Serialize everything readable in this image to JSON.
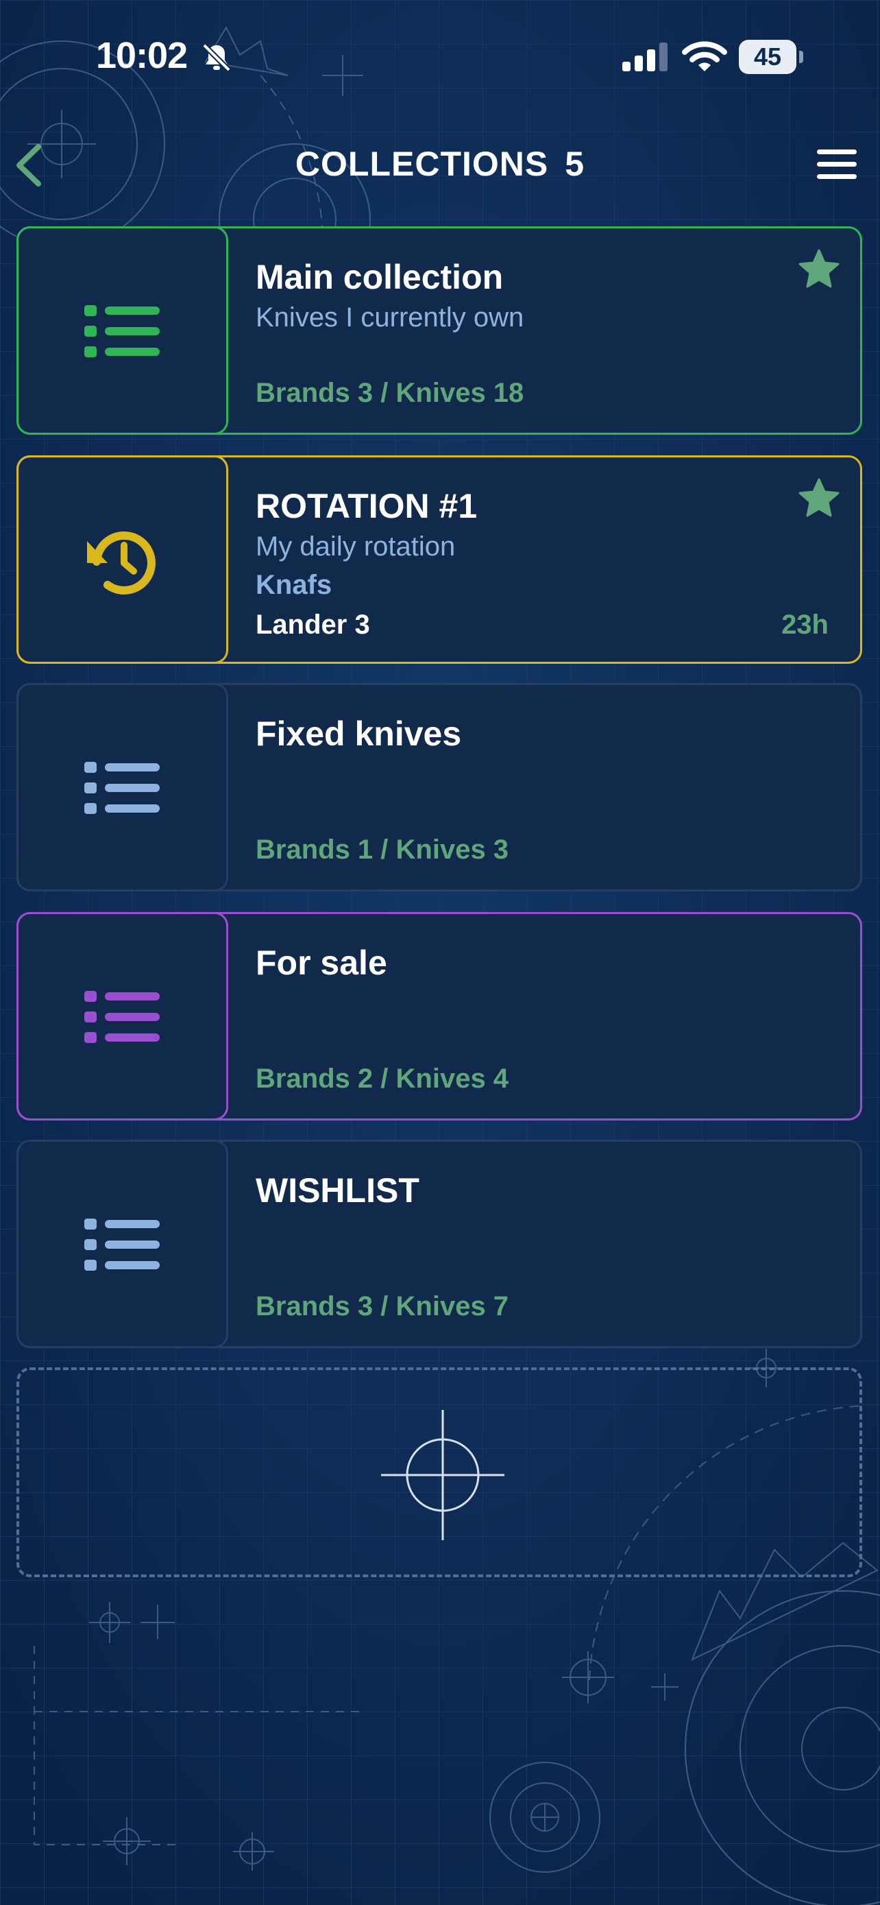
{
  "status_bar": {
    "time": "10:02",
    "battery": "45"
  },
  "header": {
    "title": "COLLECTIONS",
    "count": "5"
  },
  "collections": [
    {
      "name": "Main collection",
      "description": "Knives I currently own",
      "stats": "Brands 3 / Knives 18",
      "color": "#2fb553",
      "icon": "list-icon",
      "starred": true
    },
    {
      "name": "ROTATION #1",
      "description": "My daily rotation",
      "brand": "Knafs",
      "knife": "Lander 3",
      "time": "23h",
      "color": "#d9b81e",
      "icon": "history-icon",
      "starred": true
    },
    {
      "name": "Fixed knives",
      "stats": "Brands 1 / Knives 3",
      "color": "#8fb3e0",
      "icon": "list-icon"
    },
    {
      "name": "For sale",
      "stats": "Brands 2 / Knives 4",
      "color": "#9a4fd0",
      "icon": "list-icon"
    },
    {
      "name": "WISHLIST",
      "stats": "Brands 3 / Knives 7",
      "color": "#8fb3e0",
      "icon": "list-icon"
    }
  ],
  "add_slot": {
    "icon": "crosshair-icon"
  }
}
